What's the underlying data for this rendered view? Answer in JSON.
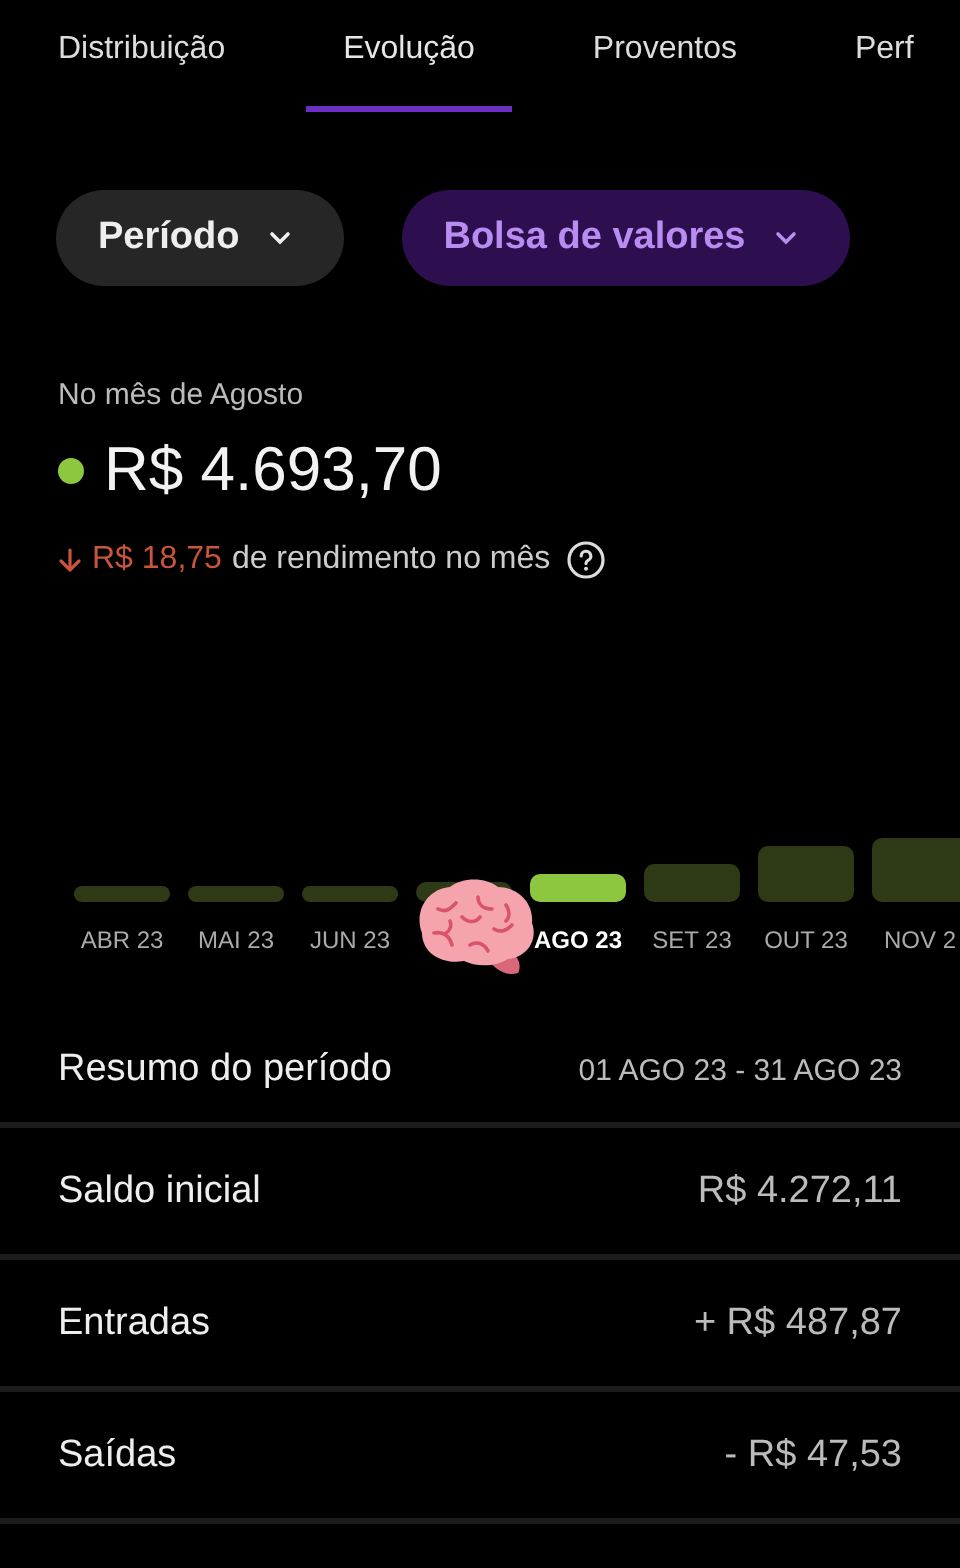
{
  "tabs": [
    {
      "label": "Distribuição",
      "selected": false
    },
    {
      "label": "Evolução",
      "selected": true
    },
    {
      "label": "Proventos",
      "selected": false
    },
    {
      "label": "Perf",
      "selected": false
    }
  ],
  "filters": [
    {
      "label": "Período",
      "kind": "neutral"
    },
    {
      "label": "Bolsa de valores",
      "kind": "accent"
    }
  ],
  "balance": {
    "caption": "No mês de Agosto",
    "value": "R$ 4.693,70"
  },
  "change": {
    "negative": true,
    "amount": "R$ 18,75",
    "text": "de rendimento no mês"
  },
  "chart": {
    "months": [
      {
        "label": "ABR 23",
        "selected": false
      },
      {
        "label": "MAI 23",
        "selected": false
      },
      {
        "label": "JUN 23",
        "selected": false
      },
      {
        "selected": false
      },
      {
        "label": "AGO 23",
        "selected": true
      },
      {
        "label": "SET 23",
        "selected": false
      },
      {
        "label": "OUT 23",
        "selected": false
      },
      {
        "label": "NOV 2",
        "selected": false
      }
    ]
  },
  "summary": {
    "title": "Resumo do período",
    "range": "01 AGO 23 - 31 AGO 23",
    "rows": [
      {
        "label": "Saldo inicial",
        "value": "R$ 4.272,11"
      },
      {
        "label": "Entradas",
        "value": "+ R$ 487,87"
      },
      {
        "label": "Saídas",
        "value": "- R$ 47,53"
      }
    ]
  }
}
